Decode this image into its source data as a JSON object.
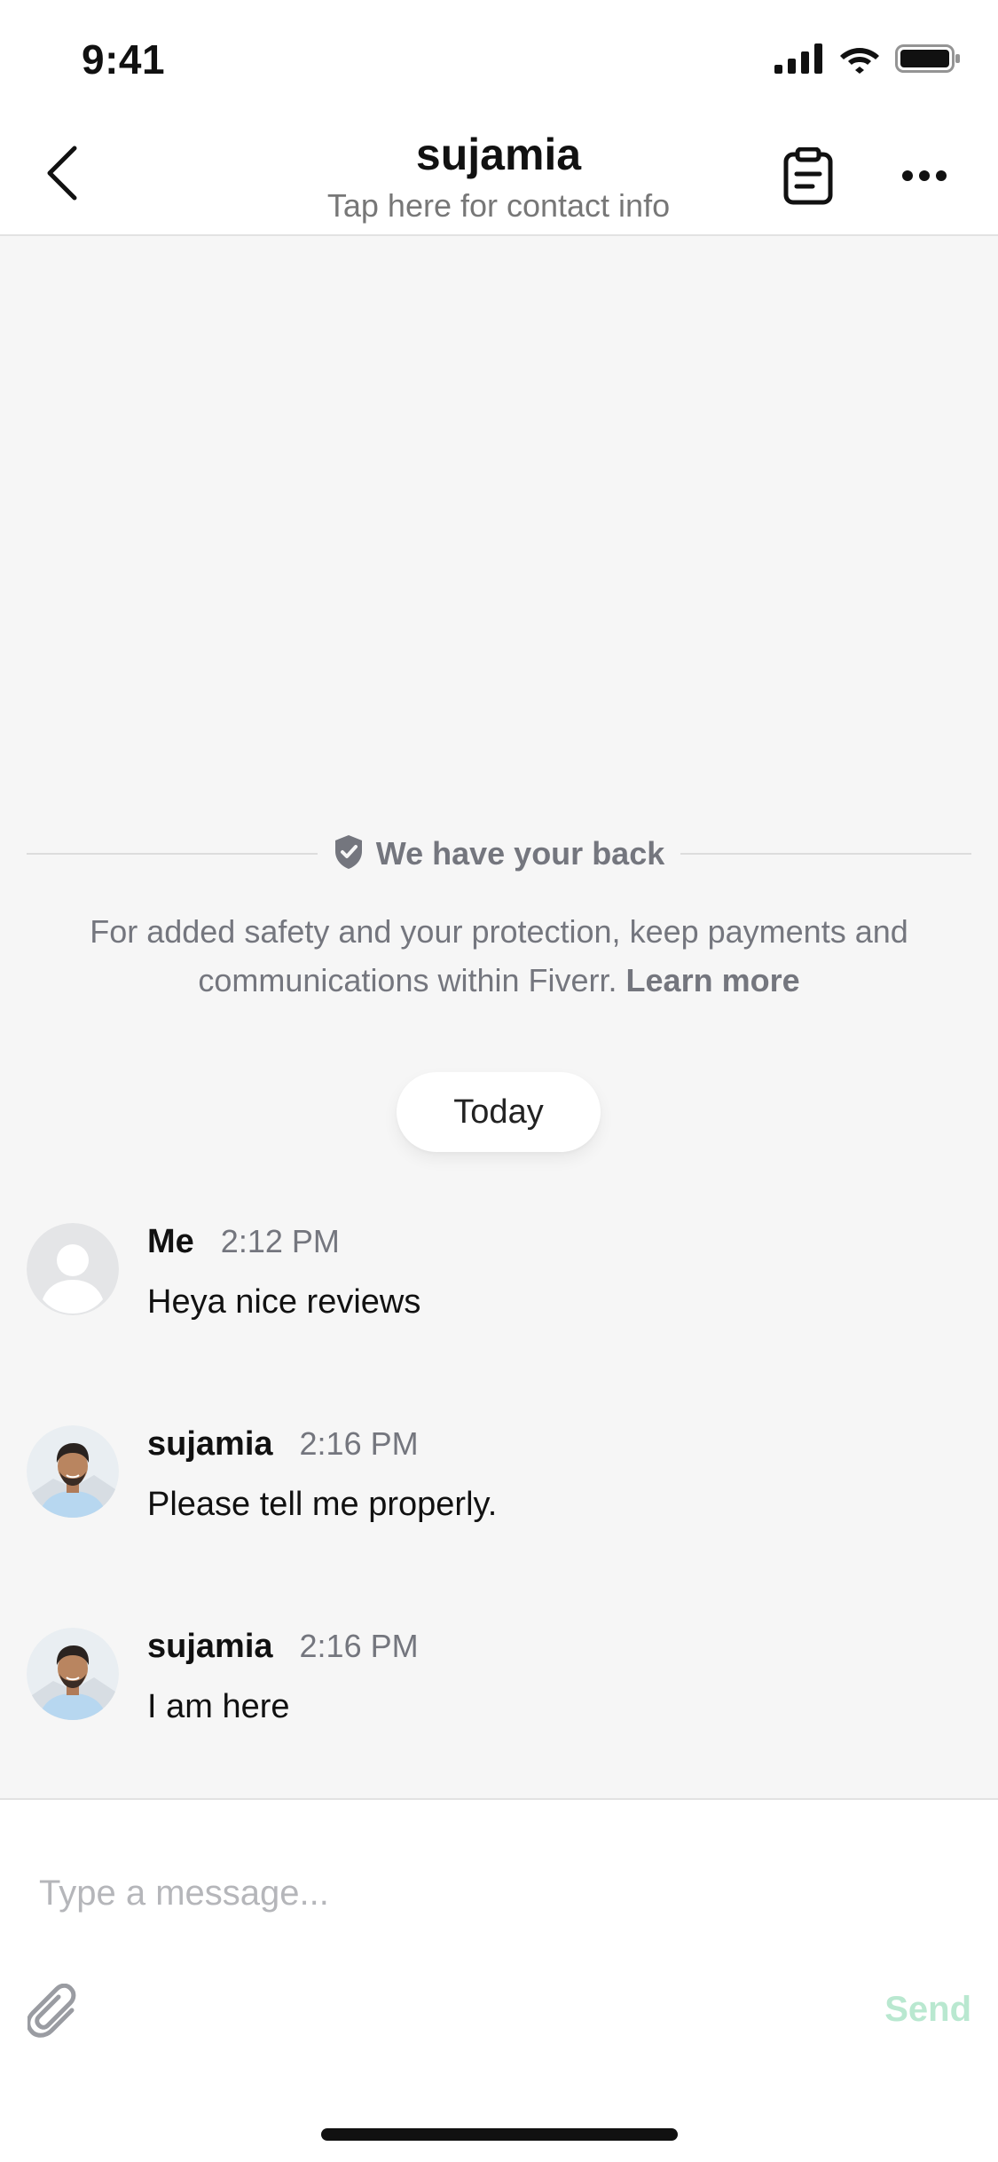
{
  "status_bar": {
    "time": "9:41"
  },
  "header": {
    "title": "sujamia",
    "subtitle": "Tap here for contact info",
    "back_icon": "chevron-left-icon",
    "order_icon": "clipboard-icon",
    "more_icon": "more-horizontal-icon"
  },
  "safety": {
    "title": "We have your back",
    "icon": "shield-check-icon",
    "text": "For added safety and your protection, keep payments and communications within Fiverr.",
    "link": "Learn more"
  },
  "date_divider": "Today",
  "messages": [
    {
      "sender": "Me",
      "time": "2:12 PM",
      "text": "Heya nice reviews",
      "avatar": "default-user-avatar"
    },
    {
      "sender": "sujamia",
      "time": "2:16 PM",
      "text": "Please tell me properly.",
      "avatar": "contact-photo-avatar"
    },
    {
      "sender": "sujamia",
      "time": "2:16 PM",
      "text": "I am here",
      "avatar": "contact-photo-avatar"
    }
  ],
  "composer": {
    "placeholder": "Type a message...",
    "attach_icon": "paperclip-icon",
    "send_label": "Send"
  },
  "colors": {
    "muted_text": "#74767e",
    "send_disabled": "#b9e8d0",
    "chat_background": "#f6f6f6"
  }
}
